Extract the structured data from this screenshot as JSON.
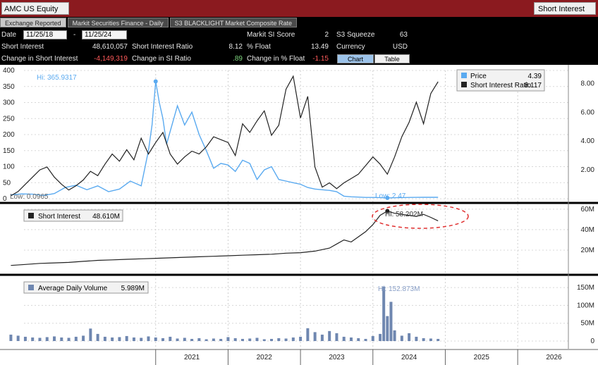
{
  "header": {
    "ticker": "AMC US Equity",
    "function": "Short Interest"
  },
  "tabs": [
    {
      "label": "Exchange Reported",
      "active": true
    },
    {
      "label": "Markit Securities Finance - Daily",
      "active": false
    },
    {
      "label": "S3 BLACKLIGHT Market Composite Rate",
      "active": false
    }
  ],
  "stats": {
    "date_label": "Date",
    "date_from": "11/25/18",
    "date_to": "11/25/24",
    "date_sep": "-",
    "markit_score_label": "Markit SI Score",
    "markit_score": "2",
    "s3_squeeze_label": "S3 Squeeze",
    "s3_squeeze": "63",
    "short_interest_label": "Short Interest",
    "short_interest": "48,610,057",
    "si_ratio_label": "Short Interest Ratio",
    "si_ratio": "8.12",
    "pct_float_label": "% Float",
    "pct_float": "13.49",
    "currency_label": "Currency",
    "currency": "USD",
    "chg_si_label": "Change in Short Interest",
    "chg_si": "-4,149,319",
    "chg_ratio_label": "Change in SI Ratio",
    "chg_ratio": ".89",
    "chg_float_label": "Change in % Float",
    "chg_float": "-1.15",
    "view_chart": "Chart",
    "view_table": "Table"
  },
  "colors": {
    "price": "#5aaaf0",
    "ratio": "#222222",
    "volume": "#6f87b0",
    "accent": "#8b1a1f",
    "annotation": "#e03030"
  },
  "chart_data": [
    {
      "type": "line",
      "panel": "price_and_ratio",
      "legend": [
        {
          "name": "Price",
          "value": "4.39"
        },
        {
          "name": "Short Interest Ratio",
          "value": "8.117"
        }
      ],
      "left_ticks": [
        "400",
        "350",
        "300",
        "250",
        "200",
        "150",
        "100",
        "50",
        "0"
      ],
      "right_ticks": [
        "8.00",
        "6.00",
        "4.00",
        "2.00"
      ],
      "ylim_left": [
        0,
        400
      ],
      "ylim_right": [
        0,
        8.9
      ],
      "annotations": {
        "high": "Hi: 365.9317",
        "low_left": "Low: 0.0965",
        "low_right": "Low: 2.47"
      },
      "series": [
        {
          "name": "Price",
          "axis": "left",
          "x": [
            2019.0,
            2019.15,
            2019.3,
            2019.45,
            2019.6,
            2019.75,
            2019.9,
            2020.05,
            2020.2,
            2020.35,
            2020.5,
            2020.65,
            2020.8,
            2020.9,
            2020.95,
            2021.0,
            2021.05,
            2021.1,
            2021.15,
            2021.2,
            2021.3,
            2021.4,
            2021.5,
            2021.6,
            2021.7,
            2021.8,
            2021.9,
            2022.0,
            2022.1,
            2022.2,
            2022.3,
            2022.4,
            2022.5,
            2022.6,
            2022.7,
            2022.8,
            2022.9,
            2023.0,
            2023.1,
            2023.2,
            2023.3,
            2023.4,
            2023.5,
            2023.6,
            2023.7,
            2023.8,
            2023.9,
            2024.0,
            2024.1,
            2024.2,
            2024.3,
            2024.4,
            2024.5,
            2024.6,
            2024.7,
            2024.8,
            2024.9
          ],
          "y": [
            12,
            15,
            14,
            10,
            16,
            35,
            42,
            28,
            40,
            22,
            30,
            55,
            40,
            150,
            230,
            366,
            300,
            250,
            170,
            210,
            290,
            230,
            270,
            200,
            150,
            95,
            110,
            105,
            85,
            120,
            110,
            60,
            90,
            100,
            60,
            55,
            50,
            45,
            35,
            30,
            28,
            26,
            22,
            8,
            6,
            5,
            4,
            4,
            3.5,
            2.5,
            3,
            3.5,
            4,
            4.2,
            4.4,
            4.5,
            4.39
          ]
        },
        {
          "name": "Short Interest Ratio",
          "axis": "right",
          "x": [
            2019.0,
            2019.1,
            2019.2,
            2019.3,
            2019.4,
            2019.5,
            2019.6,
            2019.7,
            2019.8,
            2019.9,
            2020.0,
            2020.1,
            2020.2,
            2020.3,
            2020.4,
            2020.5,
            2020.6,
            2020.7,
            2020.8,
            2020.9,
            2021.0,
            2021.1,
            2021.2,
            2021.3,
            2021.4,
            2021.5,
            2021.6,
            2021.7,
            2021.8,
            2021.9,
            2022.0,
            2022.1,
            2022.2,
            2022.3,
            2022.4,
            2022.5,
            2022.6,
            2022.7,
            2022.8,
            2022.9,
            2023.0,
            2023.1,
            2023.2,
            2023.3,
            2023.4,
            2023.5,
            2023.6,
            2023.7,
            2023.8,
            2023.9,
            2024.0,
            2024.1,
            2024.2,
            2024.3,
            2024.4,
            2024.5,
            2024.6,
            2024.7,
            2024.8,
            2024.9
          ],
          "y": [
            0.2,
            0.5,
            1.0,
            1.5,
            2.0,
            2.2,
            1.5,
            1.0,
            0.6,
            0.9,
            1.3,
            1.9,
            1.6,
            2.4,
            3.1,
            2.6,
            3.4,
            2.7,
            4.2,
            3.1,
            3.9,
            4.6,
            3.1,
            2.4,
            2.9,
            3.3,
            3.1,
            3.6,
            4.3,
            4.1,
            3.9,
            3.0,
            5.2,
            4.6,
            5.4,
            6.1,
            4.4,
            5.1,
            7.6,
            8.5,
            5.6,
            7.1,
            2.2,
            0.8,
            1.1,
            0.7,
            1.1,
            1.4,
            1.7,
            2.3,
            2.9,
            2.4,
            1.7,
            2.9,
            4.3,
            5.3,
            6.7,
            5.2,
            7.3,
            8.117
          ]
        }
      ]
    },
    {
      "type": "line",
      "panel": "short_interest",
      "legend": [
        {
          "name": "Short Interest",
          "value": "48.610M"
        }
      ],
      "right_ticks": [
        "60M",
        "40M",
        "20M"
      ],
      "ylim": [
        0,
        62000000
      ],
      "annotations": {
        "high": "Hi: 58.202M"
      },
      "series": [
        {
          "name": "Short Interest",
          "x": [
            2019.0,
            2019.2,
            2019.4,
            2019.6,
            2019.8,
            2020.0,
            2020.2,
            2020.4,
            2020.6,
            2020.8,
            2021.0,
            2021.2,
            2021.4,
            2021.6,
            2021.8,
            2022.0,
            2022.2,
            2022.4,
            2022.6,
            2022.8,
            2023.0,
            2023.2,
            2023.4,
            2023.5,
            2023.6,
            2023.7,
            2023.8,
            2023.9,
            2024.0,
            2024.1,
            2024.2,
            2024.3,
            2024.4,
            2024.5,
            2024.6,
            2024.7,
            2024.8,
            2024.9
          ],
          "y": [
            5000000,
            6000000,
            7000000,
            7500000,
            8000000,
            9000000,
            10000000,
            10500000,
            11000000,
            11500000,
            12000000,
            12500000,
            13000000,
            13500000,
            14000000,
            14500000,
            15000000,
            15500000,
            16000000,
            17000000,
            17500000,
            19000000,
            22000000,
            26000000,
            30000000,
            28000000,
            33000000,
            38000000,
            45000000,
            54000000,
            58202000,
            56000000,
            55000000,
            54000000,
            53000000,
            55000000,
            52000000,
            48610000
          ]
        }
      ]
    },
    {
      "type": "bar",
      "panel": "volume",
      "legend": [
        {
          "name": "Average Daily Volume",
          "value": "5.989M"
        }
      ],
      "right_ticks": [
        "150M",
        "100M",
        "50M",
        "0"
      ],
      "ylim": [
        0,
        170000000
      ],
      "annotations": {
        "high": "Hi: 152.873M"
      },
      "x_ticks": [
        "2021",
        "2022",
        "2023",
        "2024",
        "2025",
        "2026"
      ],
      "series": [
        {
          "name": "Average Daily Volume",
          "x": [
            2019.0,
            2019.1,
            2019.2,
            2019.3,
            2019.4,
            2019.5,
            2019.6,
            2019.7,
            2019.8,
            2019.9,
            2020.0,
            2020.1,
            2020.2,
            2020.3,
            2020.4,
            2020.5,
            2020.6,
            2020.7,
            2020.8,
            2020.9,
            2021.0,
            2021.1,
            2021.2,
            2021.3,
            2021.4,
            2021.5,
            2021.6,
            2021.7,
            2021.8,
            2021.9,
            2022.0,
            2022.1,
            2022.2,
            2022.3,
            2022.4,
            2022.5,
            2022.6,
            2022.7,
            2022.8,
            2022.9,
            2023.0,
            2023.1,
            2023.2,
            2023.3,
            2023.4,
            2023.5,
            2023.6,
            2023.7,
            2023.8,
            2023.9,
            2024.0,
            2024.1,
            2024.15,
            2024.2,
            2024.25,
            2024.3,
            2024.4,
            2024.5,
            2024.6,
            2024.7,
            2024.8,
            2024.9
          ],
          "y": [
            18000000,
            15000000,
            12000000,
            10000000,
            9000000,
            11000000,
            13000000,
            10000000,
            9000000,
            12000000,
            15000000,
            35000000,
            20000000,
            12000000,
            10000000,
            11000000,
            14000000,
            10000000,
            9000000,
            13000000,
            10000000,
            8000000,
            12000000,
            7000000,
            9000000,
            6000000,
            8000000,
            5000000,
            7000000,
            6000000,
            11000000,
            8000000,
            6000000,
            7000000,
            9000000,
            5000000,
            6000000,
            8000000,
            7000000,
            10000000,
            12000000,
            36000000,
            25000000,
            18000000,
            28000000,
            22000000,
            12000000,
            10000000,
            8000000,
            6000000,
            14000000,
            20000000,
            152873000,
            70000000,
            110000000,
            30000000,
            15000000,
            22000000,
            12000000,
            8000000,
            7000000,
            5989000
          ]
        }
      ]
    }
  ]
}
